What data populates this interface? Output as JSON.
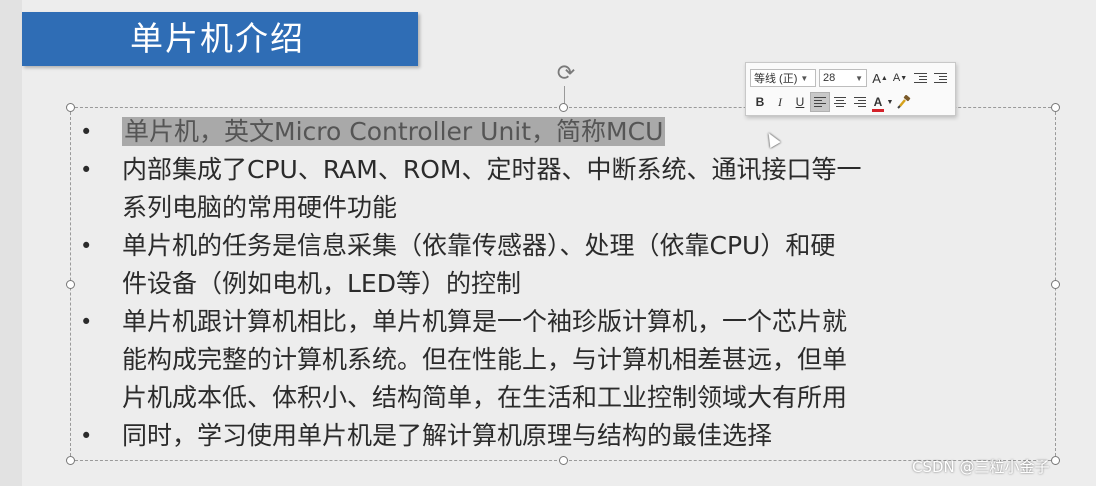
{
  "slide": {
    "title": "单片机介绍",
    "bullets": [
      {
        "lines": [
          "单片机，英文Micro Controller Unit，简称MCU"
        ],
        "highlighted": true
      },
      {
        "lines": [
          "内部集成了CPU、RAM、ROM、定时器、中断系统、通讯接口等一",
          "系列电脑的常用硬件功能"
        ]
      },
      {
        "lines": [
          "单片机的任务是信息采集（依靠传感器）、处理（依靠CPU）和硬",
          "件设备（例如电机，LED等）的控制"
        ]
      },
      {
        "lines": [
          "单片机跟计算机相比，单片机算是一个袖珍版计算机，一个芯片就",
          "能构成完整的计算机系统。但在性能上，与计算机相差甚远，但单",
          "片机成本低、体积小、结构简单，在生活和工业控制领域大有所用"
        ]
      },
      {
        "lines": [
          "同时，学习使用单片机是了解计算机原理与结构的最佳选择"
        ]
      }
    ],
    "bullet_symbol": "•"
  },
  "toolbar": {
    "font_name": "等线 (正)",
    "font_size": "28",
    "grow_font": "A",
    "shrink_font": "A",
    "bold": "B",
    "italic": "I",
    "underline": "U",
    "font_color_letter": "A",
    "font_color": "#d4232b",
    "active_alignment": "align-left"
  },
  "watermark": "CSDN @三粒小金子",
  "colors": {
    "title_banner": "#2f6db5",
    "selection_highlight": "#a9a9a9"
  }
}
